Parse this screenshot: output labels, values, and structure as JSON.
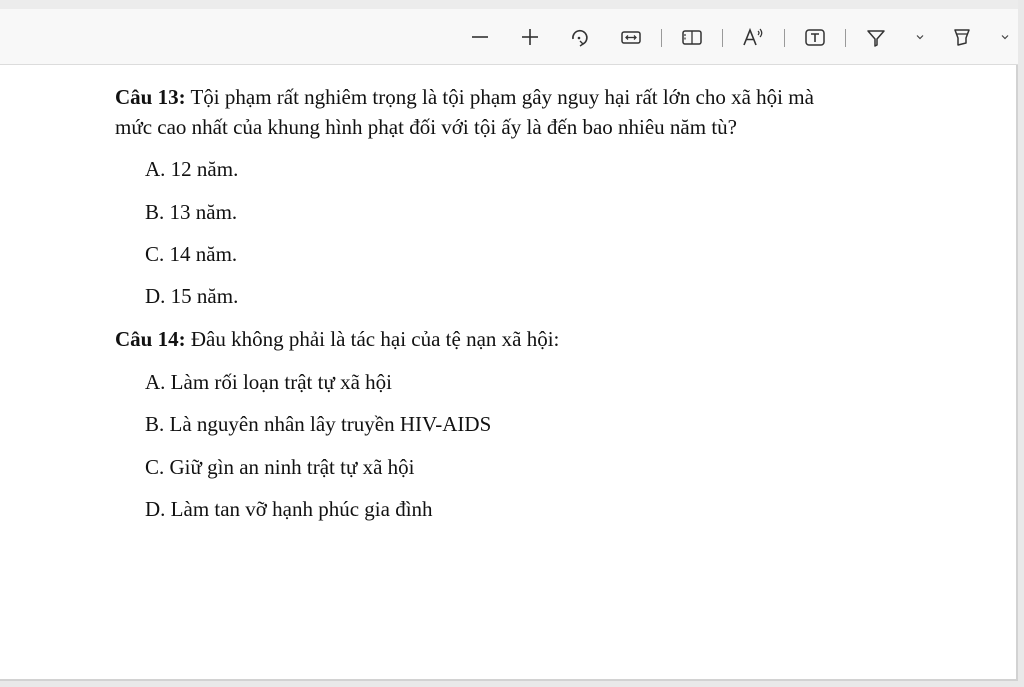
{
  "toolbar": {
    "icons": [
      "minus-icon",
      "plus-icon",
      "rotate-icon",
      "fit-width-icon",
      "page-view-icon",
      "read-aloud-icon",
      "text-box-icon",
      "highlight-icon",
      "chevron-down-icon",
      "draw-icon",
      "chevron-down-icon"
    ]
  },
  "document": {
    "q13": {
      "label": "Câu 13:",
      "text_line1": " Tội phạm rất nghiêm trọng là tội phạm gây nguy hại rất lớn cho xã hội mà",
      "text_line2": "mức cao nhất của khung hình phạt đối với tội ấy là đến bao nhiêu năm tù?",
      "options": [
        "A. 12 năm.",
        "B. 13 năm.",
        "C. 14 năm.",
        "D. 15 năm."
      ]
    },
    "q14": {
      "label": "Câu 14:",
      "text": " Đâu không phải là tác hại của tệ nạn xã hội:",
      "options": [
        "A. Làm rối loạn trật tự xã hội",
        "B. Là nguyên nhân lây truyền HIV-AIDS",
        "C. Giữ gìn an ninh trật tự xã hội",
        "D. Làm tan vỡ hạnh phúc gia đình"
      ]
    }
  }
}
